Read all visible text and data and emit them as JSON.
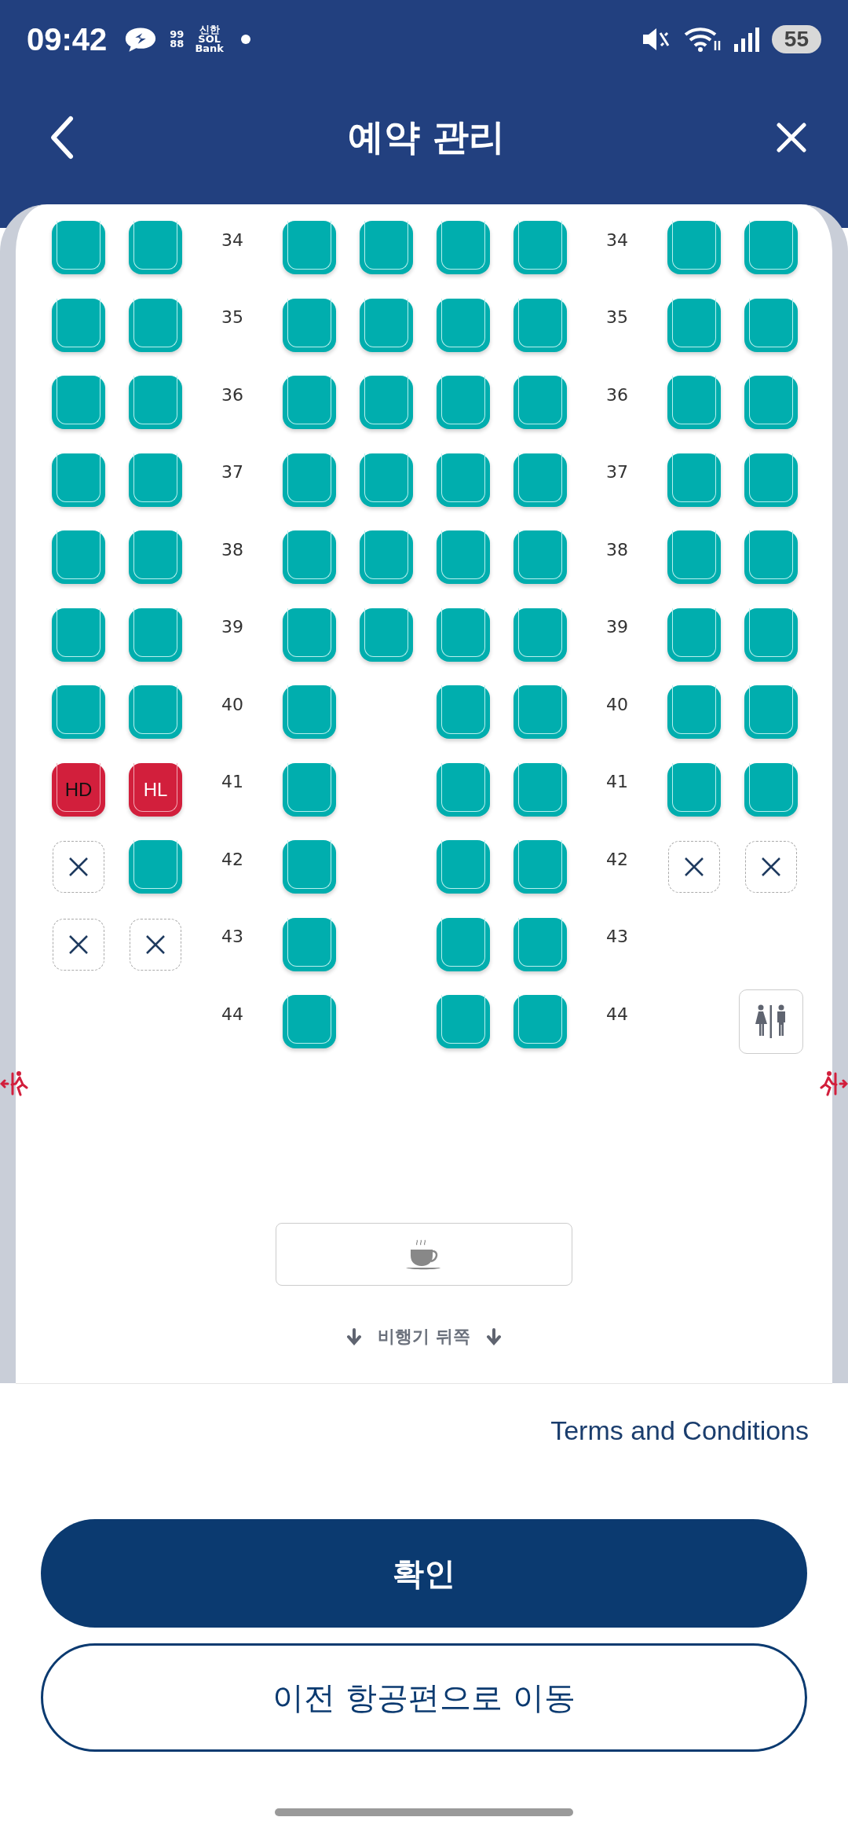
{
  "status_bar": {
    "time": "09:42",
    "notifications": [
      {
        "kind": "chat"
      },
      {
        "kind": "logo",
        "lines": [
          "99",
          "88"
        ]
      },
      {
        "kind": "logo",
        "lines": [
          "신한",
          "SOL",
          "Bank"
        ]
      },
      {
        "kind": "dot"
      }
    ],
    "battery": "55"
  },
  "header": {
    "title": "예약 관리"
  },
  "seat_map": {
    "rows": [
      {
        "numbers": [
          "34",
          "34"
        ],
        "seats": [
          {
            "kind": "available"
          },
          {
            "kind": "available"
          },
          {
            "kind": "available"
          },
          {
            "kind": "available"
          },
          {
            "kind": "available"
          },
          {
            "kind": "available"
          },
          {
            "kind": "available"
          },
          {
            "kind": "available"
          }
        ]
      },
      {
        "numbers": [
          "35",
          "35"
        ],
        "seats": [
          {
            "kind": "available"
          },
          {
            "kind": "available"
          },
          {
            "kind": "available"
          },
          {
            "kind": "available"
          },
          {
            "kind": "available"
          },
          {
            "kind": "available"
          },
          {
            "kind": "available"
          },
          {
            "kind": "available"
          }
        ]
      },
      {
        "numbers": [
          "36",
          "36"
        ],
        "seats": [
          {
            "kind": "available"
          },
          {
            "kind": "available"
          },
          {
            "kind": "available"
          },
          {
            "kind": "available"
          },
          {
            "kind": "available"
          },
          {
            "kind": "available"
          },
          {
            "kind": "available"
          },
          {
            "kind": "available"
          }
        ]
      },
      {
        "numbers": [
          "37",
          "37"
        ],
        "seats": [
          {
            "kind": "available"
          },
          {
            "kind": "available"
          },
          {
            "kind": "available"
          },
          {
            "kind": "available"
          },
          {
            "kind": "available"
          },
          {
            "kind": "available"
          },
          {
            "kind": "available"
          },
          {
            "kind": "available"
          }
        ]
      },
      {
        "numbers": [
          "38",
          "38"
        ],
        "seats": [
          {
            "kind": "available"
          },
          {
            "kind": "available"
          },
          {
            "kind": "available"
          },
          {
            "kind": "available"
          },
          {
            "kind": "available"
          },
          {
            "kind": "available"
          },
          {
            "kind": "available"
          },
          {
            "kind": "available"
          }
        ]
      },
      {
        "numbers": [
          "39",
          "39"
        ],
        "seats": [
          {
            "kind": "available"
          },
          {
            "kind": "available"
          },
          {
            "kind": "available"
          },
          {
            "kind": "available"
          },
          {
            "kind": "available"
          },
          {
            "kind": "available"
          },
          {
            "kind": "available"
          },
          {
            "kind": "available"
          }
        ]
      },
      {
        "numbers": [
          "40",
          "40"
        ],
        "seats": [
          {
            "kind": "available"
          },
          {
            "kind": "available"
          },
          {
            "kind": "available"
          },
          {
            "kind": "none"
          },
          {
            "kind": "available"
          },
          {
            "kind": "available"
          },
          {
            "kind": "available"
          },
          {
            "kind": "available"
          }
        ]
      },
      {
        "numbers": [
          "41",
          "41"
        ],
        "seats": [
          {
            "kind": "restricted",
            "code": "HD",
            "dark_text": true
          },
          {
            "kind": "restricted",
            "code": "HL",
            "dark_text": false
          },
          {
            "kind": "available"
          },
          {
            "kind": "none"
          },
          {
            "kind": "available"
          },
          {
            "kind": "available"
          },
          {
            "kind": "available"
          },
          {
            "kind": "available"
          }
        ]
      },
      {
        "numbers": [
          "42",
          "42"
        ],
        "seats": [
          {
            "kind": "blocked"
          },
          {
            "kind": "available"
          },
          {
            "kind": "available"
          },
          {
            "kind": "none"
          },
          {
            "kind": "available"
          },
          {
            "kind": "available"
          },
          {
            "kind": "blocked"
          },
          {
            "kind": "blocked"
          }
        ]
      },
      {
        "numbers": [
          "43",
          "43"
        ],
        "seats": [
          {
            "kind": "blocked"
          },
          {
            "kind": "blocked"
          },
          {
            "kind": "available"
          },
          {
            "kind": "none"
          },
          {
            "kind": "available"
          },
          {
            "kind": "available"
          },
          {
            "kind": "none"
          },
          {
            "kind": "none"
          }
        ]
      },
      {
        "numbers": [
          "44",
          "44"
        ],
        "seats": [
          {
            "kind": "none"
          },
          {
            "kind": "none"
          },
          {
            "kind": "available"
          },
          {
            "kind": "none"
          },
          {
            "kind": "available"
          },
          {
            "kind": "available"
          },
          {
            "kind": "none"
          },
          {
            "kind": "lavatory"
          }
        ]
      }
    ],
    "exits": [
      {
        "mirrored": true
      },
      {
        "mirrored": false
      }
    ],
    "facilities": [
      {
        "kind": "galley"
      }
    ],
    "direction_label": "비행기 뒤쪽"
  },
  "terms_link": "Terms and Conditions",
  "buttons": [
    {
      "label": "확인",
      "kind": "primary"
    },
    {
      "label": "이전 항공편으로 이동",
      "kind": "secondary"
    }
  ]
}
